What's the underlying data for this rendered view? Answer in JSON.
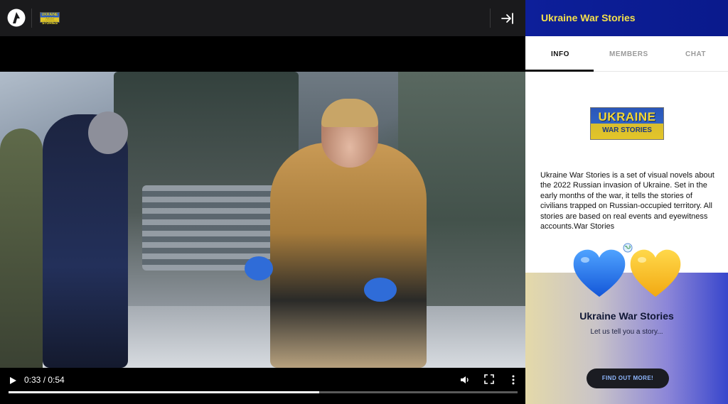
{
  "app": {
    "logo_icon": "app-logo-icon",
    "brand_badge": {
      "line1": "UKRAINE",
      "line2": "WAR STORIES"
    }
  },
  "player": {
    "collapse_icon": "collapse-panel-icon",
    "time_display": "0:33 / 0:54",
    "progress_fraction": 0.61,
    "buffered_fraction": 0.61,
    "controls": {
      "play_icon": "play-icon",
      "volume_icon": "volume-icon",
      "fullscreen_icon": "fullscreen-icon",
      "more_icon": "more-vertical-icon"
    }
  },
  "panel": {
    "title": "Ukraine War Stories",
    "header_color": "#0d1f9a",
    "title_color": "#f5e14b",
    "tabs": [
      {
        "label": "INFO",
        "active": true
      },
      {
        "label": "MEMBERS",
        "active": false
      },
      {
        "label": "CHAT",
        "active": false
      }
    ],
    "logo": {
      "line1": "UKRAINE",
      "line2": "WAR STORIES"
    },
    "description": "Ukraine War Stories is a set of visual novels about the 2022 Russian invasion of Ukraine. Set in the early months of the war, it tells the stories of civilians trapped on Russian-occupied territory. All stories are based on real events and eyewitness accounts.War Stories",
    "promo": {
      "title": "Ukraine War Stories",
      "subtitle": "Let us tell you a story...",
      "button_label": "FIND OUT MORE!",
      "hearts": [
        "blue-heart-icon",
        "yellow-heart-icon"
      ]
    }
  }
}
